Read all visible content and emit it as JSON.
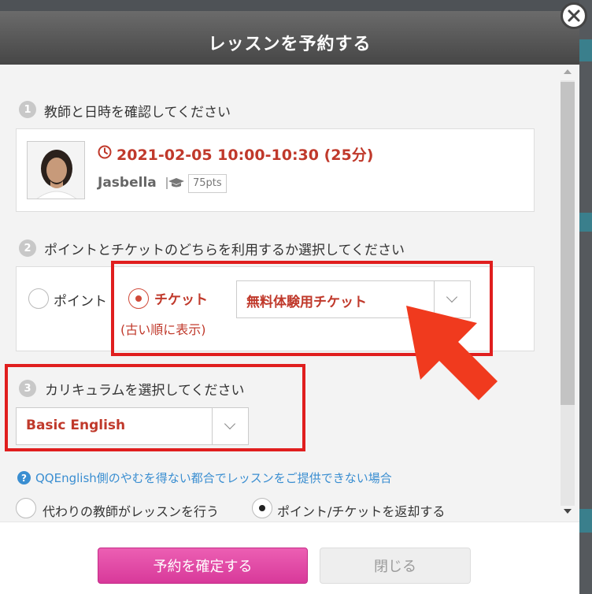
{
  "dialog": {
    "title": "レッスンを予約する",
    "close_icon": "close-x-circle-icon"
  },
  "step1": {
    "number": "1",
    "label": "教師と日時を確認してください",
    "lesson_time": "2021-02-05 10:00-10:30 (25分)",
    "teacher_name": "Jasbella",
    "teacher_points": "75pts",
    "clock_icon": "clock-icon",
    "grad_icon": "graduation-cap-icon"
  },
  "step2": {
    "number": "2",
    "label": "ポイントとチケットのどちらを利用するか選択してください",
    "option_points": "ポイント",
    "option_ticket": "チケット",
    "ticket_note": "(古い順に表示)",
    "ticket_select_value": "無料体験用チケット",
    "selected": "ticket"
  },
  "step3": {
    "number": "3",
    "label": "カリキュラムを選択してください",
    "curriculum_value": "Basic English"
  },
  "cancellation": {
    "info_text": "QQEnglish側のやむを得ない都合でレッスンをご提供できない場合",
    "option_substitute": "代わりの教師がレッスンを行う",
    "option_refund": "ポイント/チケットを返却する",
    "selected": "refund"
  },
  "footer": {
    "confirm_label": "予約を確定する",
    "close_label": "閉じる"
  },
  "colors": {
    "accent_red": "#c0392b",
    "confirm_pink": "#e04aa8",
    "highlight_red": "#e01e1e",
    "link_blue": "#3a8ed1"
  }
}
